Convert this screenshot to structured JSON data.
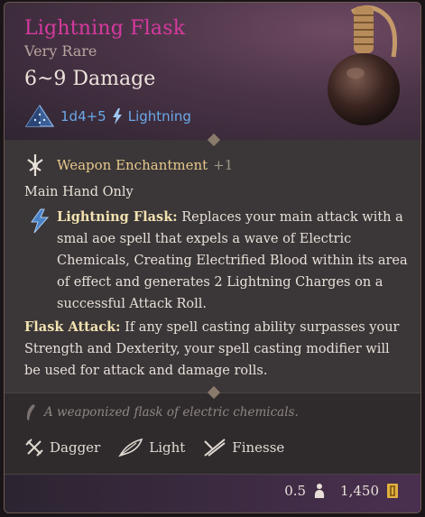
{
  "item": {
    "name": "Lightning Flask",
    "rarity": "Very Rare",
    "damage": "6~9 Damage",
    "damage_dice": "1d4+5",
    "damage_type": "Lightning"
  },
  "enchantment": {
    "label": "Weapon Enchantment",
    "bonus": "+1"
  },
  "requirements": "Main Hand Only",
  "ability": {
    "name": "Lightning Flask:",
    "text": " Replaces your main attack with a smal aoe spell that expels a wave of Electric Chemicals, Creating Electrified Blood within its area of effect and generates 2 Lightning Charges on a successful Attack Roll."
  },
  "flask_attack": {
    "name": "Flask Attack:",
    "text": " If any spell casting ability surpasses your Strength and Dexterity, your spell casting modifier will be used for attack and damage rolls."
  },
  "flavor": "A weaponized flask of electric chemicals.",
  "properties": [
    {
      "label": "Dagger",
      "icon": "dagger-icon"
    },
    {
      "label": "Light",
      "icon": "feather-icon"
    },
    {
      "label": "Finesse",
      "icon": "finesse-icon"
    }
  ],
  "footer": {
    "weight": "0.5",
    "value": "1,450"
  },
  "colors": {
    "title": "#d63aa0",
    "lightning": "#6aa8e8",
    "enchant": "#e6c98a"
  }
}
